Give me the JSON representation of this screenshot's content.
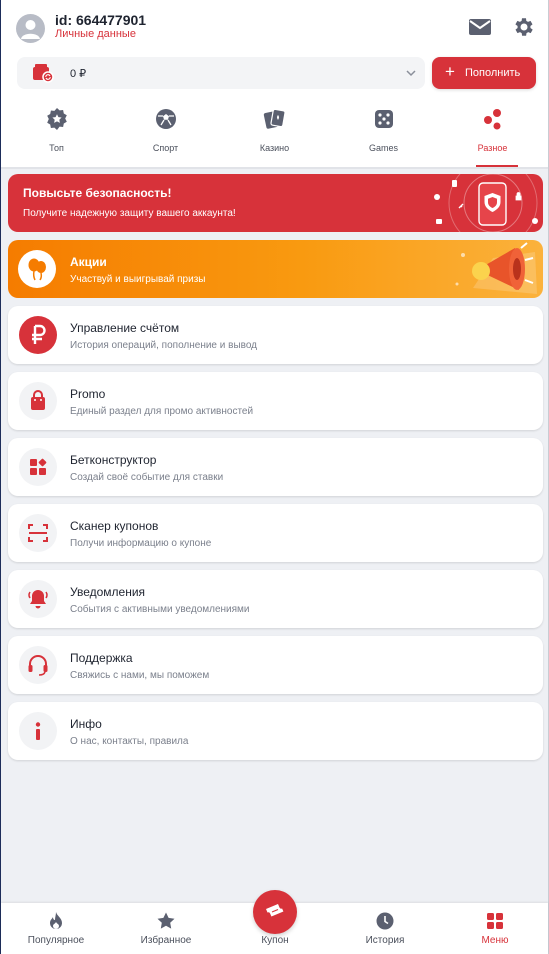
{
  "colors": {
    "accent": "#d7323a",
    "promo": "#f99a10",
    "background": "#eef0f4"
  },
  "header": {
    "user_id": "id: 664477901",
    "personal_data_link": "Личные данные",
    "balance": "0 ₽",
    "deposit_label": "Пополнить",
    "icons": [
      "avatar",
      "mail-icon",
      "gear-icon",
      "wallet-icon"
    ]
  },
  "tabs": [
    {
      "label": "Топ",
      "icon": "star-badge-icon",
      "active": false
    },
    {
      "label": "Спорт",
      "icon": "sports-ball-icon",
      "active": false
    },
    {
      "label": "Казино",
      "icon": "cards-icon",
      "active": false
    },
    {
      "label": "Games",
      "icon": "dice-icon",
      "active": false
    },
    {
      "label": "Разное",
      "icon": "misc-dots-icon",
      "active": true
    }
  ],
  "security_banner": {
    "title": "Повысьте безопасность!",
    "subtitle": "Получите надежную защиту вашего аккаунта!"
  },
  "promo_banner": {
    "title": "Акции",
    "subtitle": "Участвуй и выигрывай призы"
  },
  "menu": [
    {
      "title": "Управление счётом",
      "subtitle": "История операций, пополнение и вывод",
      "icon": "ruble-icon"
    },
    {
      "title": "Promo",
      "subtitle": "Единый раздел для промо активностей",
      "icon": "shopping-bag-icon"
    },
    {
      "title": "Бетконструктор",
      "subtitle": "Создай своё событие для ставки",
      "icon": "constructor-blocks-icon"
    },
    {
      "title": "Сканер купонов",
      "subtitle": "Получи информацию о купоне",
      "icon": "scanner-icon"
    },
    {
      "title": "Уведомления",
      "subtitle": "События с активными уведомлениями",
      "icon": "bell-icon"
    },
    {
      "title": "Поддержка",
      "subtitle": "Свяжись с нами, мы поможем",
      "icon": "headset-icon"
    },
    {
      "title": "Инфо",
      "subtitle": "О нас, контакты, правила",
      "icon": "info-icon"
    }
  ],
  "bottom_nav": [
    {
      "label": "Популярное",
      "icon": "flame-icon",
      "active": false
    },
    {
      "label": "Избранное",
      "icon": "star-icon",
      "active": false
    },
    {
      "label": "Купон",
      "icon": "ticket-icon",
      "active": false
    },
    {
      "label": "История",
      "icon": "clock-icon",
      "active": false
    },
    {
      "label": "Меню",
      "icon": "grid-icon",
      "active": true
    }
  ]
}
